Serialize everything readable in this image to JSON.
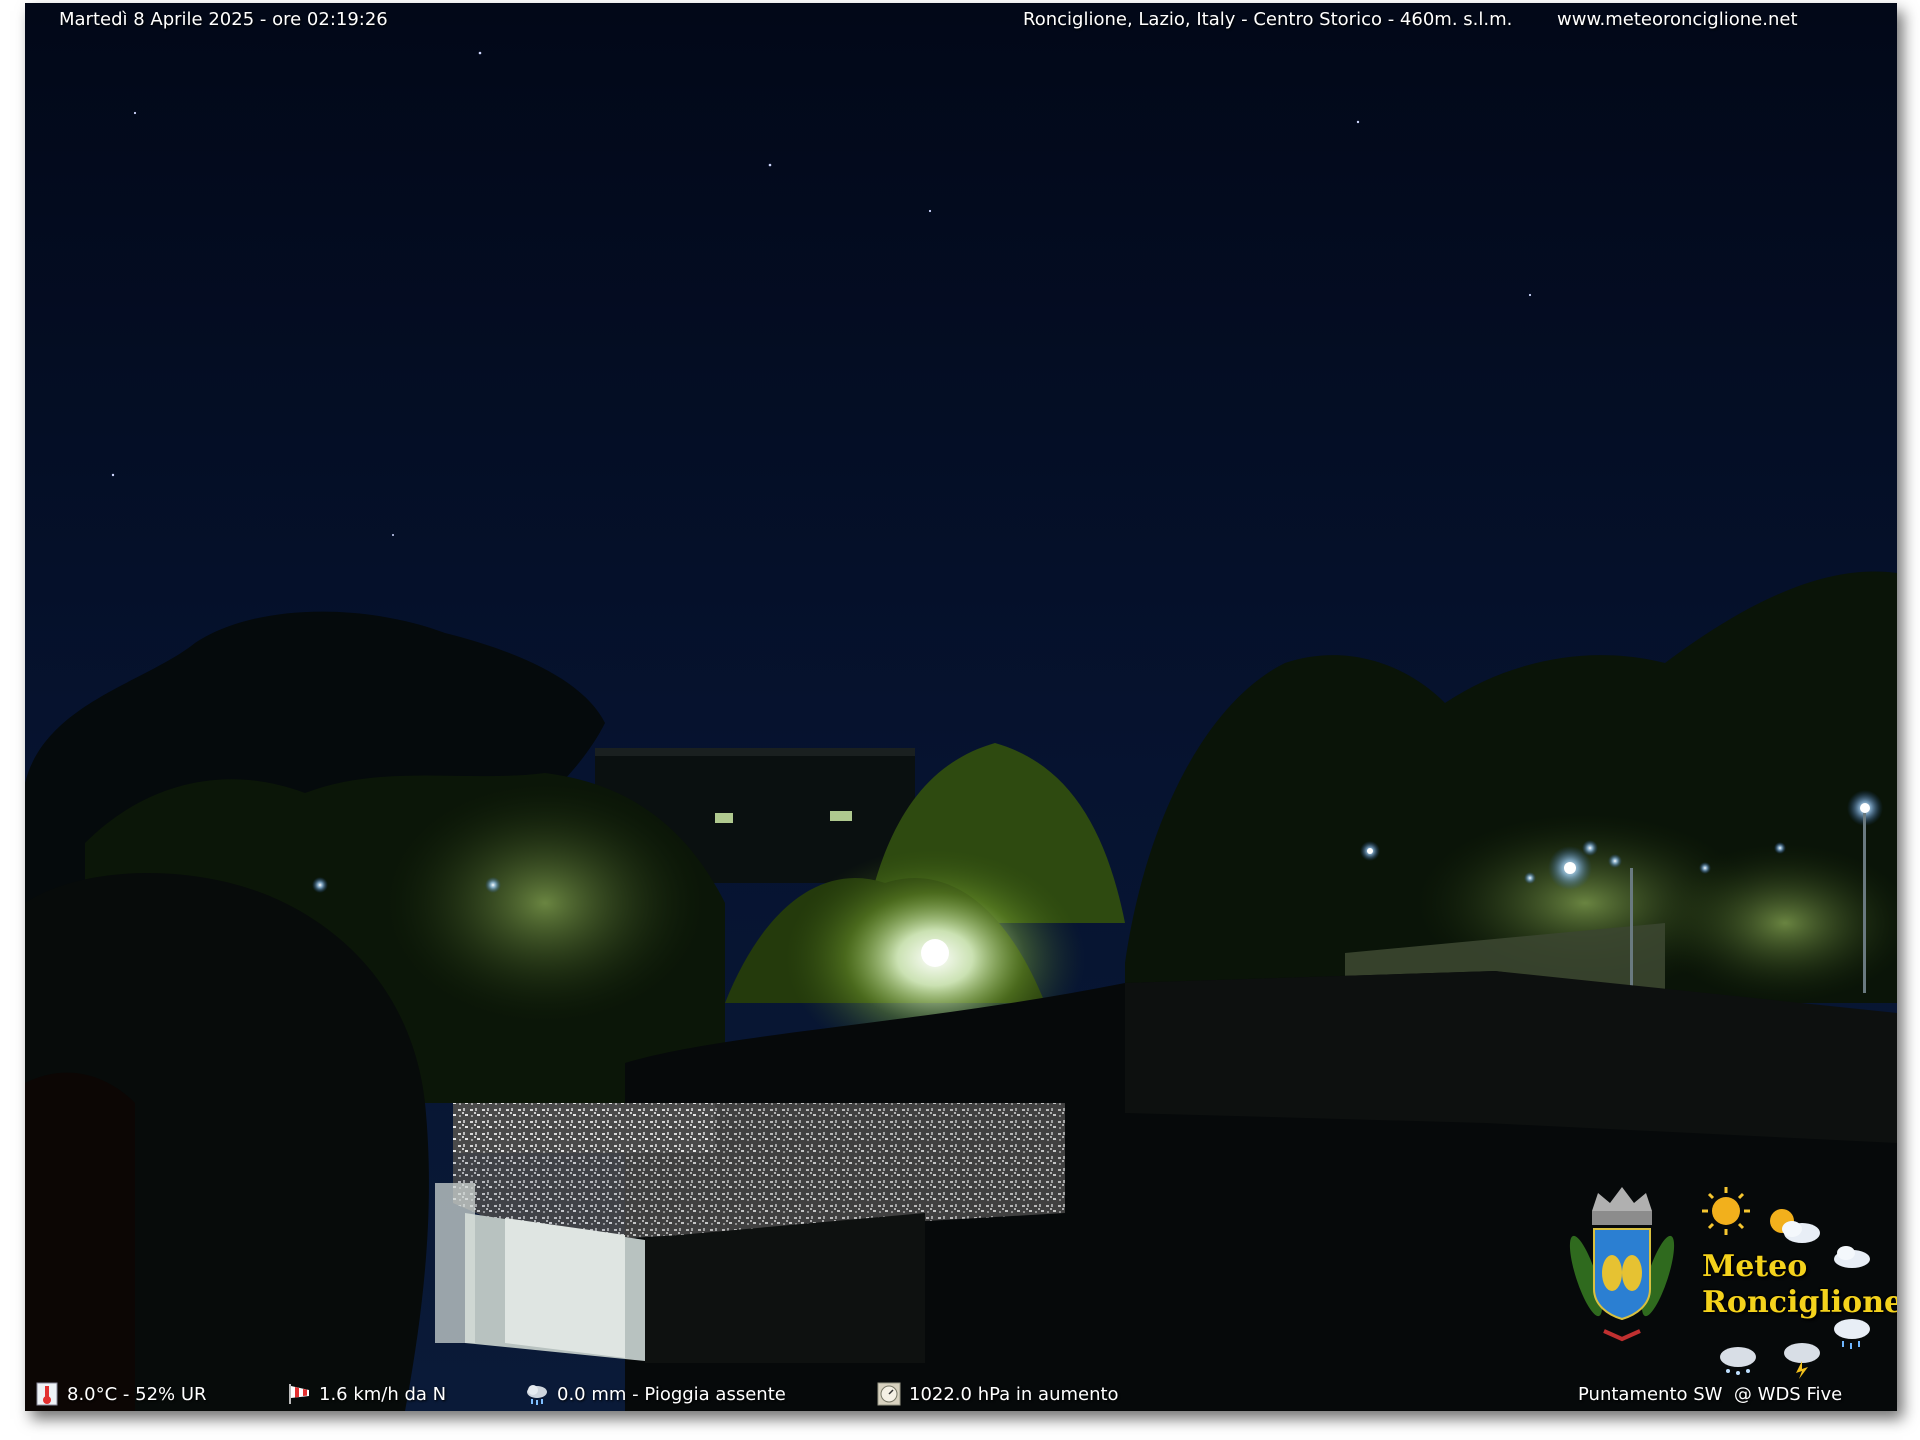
{
  "overlay": {
    "timestamp": "Martedì 8 Aprile 2025 - ore 02:19:26",
    "location": "Ronciglione, Lazio, Italy - Centro Storico - 460m. s.l.m.",
    "website": "www.meteoronciglione.net"
  },
  "status_bar": {
    "temperature": "8.0°C - 52% UR",
    "wind": "1.6 km/h da N",
    "rain": "0.0 mm - Pioggia assente",
    "pressure": "1022.0 hPa in aumento",
    "pointing": "Puntamento SW  @ WDS Five"
  },
  "icons": {
    "temperature": "thermometer-icon",
    "wind": "windsock-icon",
    "rain": "rain-cloud-icon",
    "pressure": "barometer-icon"
  },
  "logo": {
    "line1": "Meteo",
    "line2": "Ronciglione"
  },
  "colors": {
    "sky": "#030b1e",
    "logo_text": "#f4d21c",
    "street_light": "#cfe6ff"
  }
}
